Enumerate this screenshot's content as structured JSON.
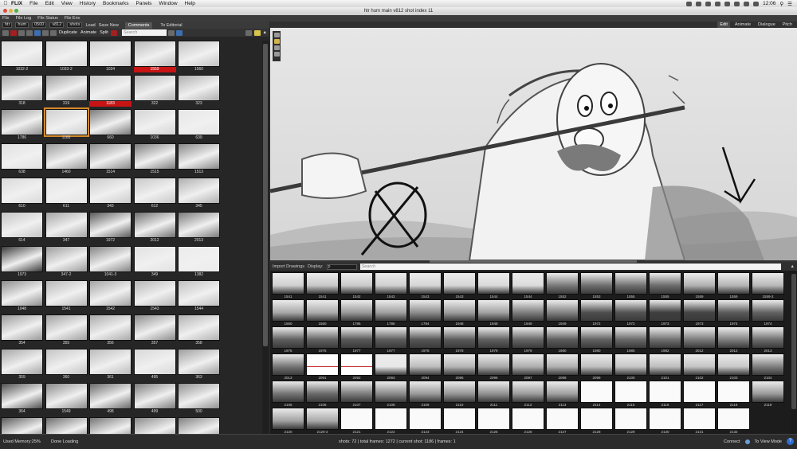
{
  "os_menu": {
    "app": "FLIX",
    "items": [
      "File",
      "Edit",
      "View",
      "History",
      "Bookmarks",
      "Panels",
      "Window",
      "Help"
    ],
    "clock": "12:06"
  },
  "window": {
    "title": "htr hum main v812 shot index 11"
  },
  "app_menu": [
    "Flix",
    "File Log",
    "Flix Status",
    "Flix Env"
  ],
  "left_toolbar": {
    "show": "htr",
    "sequence": "hum",
    "frame": "0500",
    "version": "v812",
    "filter": "shots",
    "load_label": "Load",
    "save_new_label": "Save New",
    "comments_tab": "Comments",
    "to_editorial_label": "To Editorial",
    "duplicate_label": "Duplicate",
    "animate_label": "Animate",
    "split_label": "Split",
    "search_placeholder": "Search"
  },
  "shot_cells": [
    {
      "label": "1032-2",
      "shade": "#d8d8d8"
    },
    {
      "label": "1033-2",
      "shade": "#d4d4d4"
    },
    {
      "label": "1034",
      "shade": "#cfcfcf"
    },
    {
      "label": "1559",
      "shade": "#bbbbbb",
      "highlight": true
    },
    {
      "label": "1560",
      "shade": "#c2c2c2"
    },
    {
      "label": "318",
      "shade": "#a8a8a8"
    },
    {
      "label": "319",
      "shade": "#9e9e9e"
    },
    {
      "label": "1183",
      "shade": "#c6c6c6",
      "highlight": true
    },
    {
      "label": "322",
      "shade": "#b4b4b4"
    },
    {
      "label": "323",
      "shade": "#aeaeae"
    },
    {
      "label": "1786",
      "shade": "#909090"
    },
    {
      "label": "1188",
      "shade": "#cfcfcf",
      "selected": true
    },
    {
      "label": "660",
      "shade": "#7a7a7a"
    },
    {
      "label": "1036",
      "shade": "#d4d4d4"
    },
    {
      "label": "639",
      "shade": "#e6e6e6"
    },
    {
      "label": "638",
      "shade": "#e0e0e0"
    },
    {
      "label": "1460",
      "shade": "#9a9a9a"
    },
    {
      "label": "1514",
      "shade": "#8a8a8a"
    },
    {
      "label": "1515",
      "shade": "#7c7c7c"
    },
    {
      "label": "1513",
      "shade": "#888888"
    },
    {
      "label": "610",
      "shade": "#dadada"
    },
    {
      "label": "611",
      "shade": "#e4e4e4"
    },
    {
      "label": "343",
      "shade": "#cccccc"
    },
    {
      "label": "612",
      "shade": "#c8c8c8"
    },
    {
      "label": "345",
      "shade": "#b0b0b0"
    },
    {
      "label": "614",
      "shade": "#c4c4c4"
    },
    {
      "label": "347",
      "shade": "#a6a6a6"
    },
    {
      "label": "1972",
      "shade": "#5a5a5a"
    },
    {
      "label": "2012",
      "shade": "#6e6e6e"
    },
    {
      "label": "2013",
      "shade": "#7a7a7a"
    },
    {
      "label": "1973",
      "shade": "#3a3a3a"
    },
    {
      "label": "347-2",
      "shade": "#9c9c9c"
    },
    {
      "label": "1041-3",
      "shade": "#848484"
    },
    {
      "label": "349",
      "shade": "#e2e2e2"
    },
    {
      "label": "1382",
      "shade": "#ececec"
    },
    {
      "label": "1948",
      "shade": "#8e8e8e"
    },
    {
      "label": "1541",
      "shade": "#b8b8b8"
    },
    {
      "label": "1542",
      "shade": "#a4a4a4"
    },
    {
      "label": "1543",
      "shade": "#b6b6b6"
    },
    {
      "label": "1544",
      "shade": "#c0c0c0"
    },
    {
      "label": "354",
      "shade": "#9a9a9a"
    },
    {
      "label": "355",
      "shade": "#a0a0a0"
    },
    {
      "label": "356",
      "shade": "#aaaaaa"
    },
    {
      "label": "357",
      "shade": "#8c8c8c"
    },
    {
      "label": "358",
      "shade": "#b2b2b2"
    },
    {
      "label": "359",
      "shade": "#a6a6a6"
    },
    {
      "label": "360",
      "shade": "#c4c4c4"
    },
    {
      "label": "361",
      "shade": "#bcbcbc"
    },
    {
      "label": "495",
      "shade": "#d8d8d8"
    },
    {
      "label": "363",
      "shade": "#9e9e9e"
    },
    {
      "label": "364",
      "shade": "#505050"
    },
    {
      "label": "1549",
      "shade": "#8a8a8a"
    },
    {
      "label": "498",
      "shade": "#6a6a6a"
    },
    {
      "label": "499",
      "shade": "#7c7c7c"
    },
    {
      "label": "500",
      "shade": "#909090"
    },
    {
      "label": "",
      "shade": "#5a5a5a"
    },
    {
      "label": "",
      "shade": "#6c6c6c"
    },
    {
      "label": "",
      "shade": "#747474"
    },
    {
      "label": "",
      "shade": "#8a8a8a"
    },
    {
      "label": "",
      "shade": "#808080"
    }
  ],
  "view_tabs": [
    "Edit",
    "Animate",
    "Dialogue",
    "Pitch"
  ],
  "drawings_toolbar": {
    "import_label": "Import Drawings",
    "display_label": "Display:",
    "display_value": "p",
    "search_placeholder": "Search"
  },
  "frame_cells": [
    {
      "label": "1541",
      "shade": "#d0d0d0"
    },
    {
      "label": "1541",
      "shade": "#c8c8c8"
    },
    {
      "label": "1542",
      "shade": "#cacaca"
    },
    {
      "label": "1543",
      "shade": "#d0d0d0"
    },
    {
      "label": "1543",
      "shade": "#d6d6d6"
    },
    {
      "label": "1543",
      "shade": "#d6d6d6"
    },
    {
      "label": "1544",
      "shade": "#dadada"
    },
    {
      "label": "1544",
      "shade": "#dcdcdc"
    },
    {
      "label": "1552",
      "shade": "#7a7a7a"
    },
    {
      "label": "1553",
      "shade": "#6e6e6e"
    },
    {
      "label": "1555",
      "shade": "#707070"
    },
    {
      "label": "1555",
      "shade": "#6c6c6c"
    },
    {
      "label": "1559",
      "shade": "#b0b0b0"
    },
    {
      "label": "1559",
      "shade": "#b4b4b4"
    },
    {
      "label": "1559-2",
      "shade": "#b8b8b8"
    },
    {
      "label": "1560",
      "shade": "#a8a8a8"
    },
    {
      "label": "1560",
      "shade": "#acacac"
    },
    {
      "label": "1786",
      "shade": "#9a9a9a"
    },
    {
      "label": "1786",
      "shade": "#a0a0a0"
    },
    {
      "label": "1794",
      "shade": "#8c8c8c"
    },
    {
      "label": "1948",
      "shade": "#9e9e9e"
    },
    {
      "label": "1948",
      "shade": "#a2a2a2"
    },
    {
      "label": "1949",
      "shade": "#7e7e7e"
    },
    {
      "label": "1949",
      "shade": "#828282"
    },
    {
      "label": "1972",
      "shade": "#4e4e4e"
    },
    {
      "label": "1972",
      "shade": "#525252"
    },
    {
      "label": "1973",
      "shade": "#3e3e3e"
    },
    {
      "label": "1973",
      "shade": "#444444"
    },
    {
      "label": "1974",
      "shade": "#5a5a5a"
    },
    {
      "label": "1974",
      "shade": "#626262"
    },
    {
      "label": "1975",
      "shade": "#5e5e5e"
    },
    {
      "label": "1975",
      "shade": "#646464"
    },
    {
      "label": "1977",
      "shade": "#585858"
    },
    {
      "label": "1977",
      "shade": "#5c5c5c"
    },
    {
      "label": "1978",
      "shade": "#565656"
    },
    {
      "label": "1978",
      "shade": "#5a5a5a"
    },
    {
      "label": "1979",
      "shade": "#606060"
    },
    {
      "label": "1979",
      "shade": "#666666"
    },
    {
      "label": "1980",
      "shade": "#5c5c5c"
    },
    {
      "label": "1980",
      "shade": "#626262"
    },
    {
      "label": "1980",
      "shade": "#686868"
    },
    {
      "label": "1982",
      "shade": "#707070"
    },
    {
      "label": "2012",
      "shade": "#7a7a7a"
    },
    {
      "label": "2012",
      "shade": "#808080"
    },
    {
      "label": "2013",
      "shade": "#6e6e6e"
    },
    {
      "label": "2013",
      "shade": "#747474"
    },
    {
      "label": "2091",
      "shade": "#fafafa",
      "blank": "b"
    },
    {
      "label": "2092",
      "shade": "#fafafa",
      "blank": "b"
    },
    {
      "label": "2093",
      "shade": "#e8e8e8"
    },
    {
      "label": "2094",
      "shade": "#bcbcbc"
    },
    {
      "label": "2095",
      "shade": "#b4b4b4"
    },
    {
      "label": "2096",
      "shade": "#a8a8a8"
    },
    {
      "label": "2097",
      "shade": "#aeaeae"
    },
    {
      "label": "2098",
      "shade": "#b0b0b0"
    },
    {
      "label": "2099",
      "shade": "#c0c0c0"
    },
    {
      "label": "2100",
      "shade": "#c6c6c6"
    },
    {
      "label": "2101",
      "shade": "#bebebe"
    },
    {
      "label": "2102",
      "shade": "#c4c4c4"
    },
    {
      "label": "2103",
      "shade": "#c8c8c8"
    },
    {
      "label": "2104",
      "shade": "#7e7e7e"
    },
    {
      "label": "2105",
      "shade": "#747474"
    },
    {
      "label": "2106",
      "shade": "#6a6a6a"
    },
    {
      "label": "2107",
      "shade": "#7c7c7c"
    },
    {
      "label": "2108",
      "shade": "#8a8a8a"
    },
    {
      "label": "2109",
      "shade": "#9a9a9a"
    },
    {
      "label": "2110",
      "shade": "#969696"
    },
    {
      "label": "2111",
      "shade": "#929292"
    },
    {
      "label": "2112",
      "shade": "#9c9c9c"
    },
    {
      "label": "2113",
      "shade": "#a0a0a0"
    },
    {
      "label": "2114",
      "shade": "#fafafa",
      "blank": "w"
    },
    {
      "label": "2115",
      "shade": "#fafafa",
      "blank": "w"
    },
    {
      "label": "2116",
      "shade": "#fafafa",
      "blank": "w"
    },
    {
      "label": "2117",
      "shade": "#fafafa",
      "blank": "w"
    },
    {
      "label": "2118",
      "shade": "#fafafa",
      "blank": "w"
    },
    {
      "label": "2119",
      "shade": "#9a9a9a"
    },
    {
      "label": "2120",
      "shade": "#a2a2a2"
    },
    {
      "label": "2120-2",
      "shade": "#aaaaaa"
    },
    {
      "label": "2121",
      "shade": "#fafafa",
      "blank": "w"
    },
    {
      "label": "2122",
      "shade": "#fafafa",
      "blank": "w"
    },
    {
      "label": "2123",
      "shade": "#fafafa",
      "blank": "w"
    },
    {
      "label": "2124",
      "shade": "#fafafa",
      "blank": "w"
    },
    {
      "label": "2125",
      "shade": "#fafafa",
      "blank": "w"
    },
    {
      "label": "2126",
      "shade": "#fafafa",
      "blank": "w"
    },
    {
      "label": "2127",
      "shade": "#fafafa",
      "blank": "w"
    },
    {
      "label": "2128",
      "shade": "#fafafa",
      "blank": "w"
    },
    {
      "label": "2129",
      "shade": "#fafafa",
      "blank": "w"
    },
    {
      "label": "2130",
      "shade": "#fafafa",
      "blank": "w"
    },
    {
      "label": "2131",
      "shade": "#fafafa",
      "blank": "w"
    },
    {
      "label": "2132",
      "shade": "#fafafa",
      "blank": "w"
    }
  ],
  "status": {
    "memory": "Used Memory:25%",
    "loading": "Done Loading",
    "info": "shots: 72 | total frames: 1272 | current shot: 1186 | frames: 1",
    "connect": "Connect",
    "view_mode": "To View Mode",
    "help": "?"
  },
  "colors": {
    "selection": "#d68a28",
    "highlight": "#c81414",
    "accent": "#2f6fd0"
  }
}
